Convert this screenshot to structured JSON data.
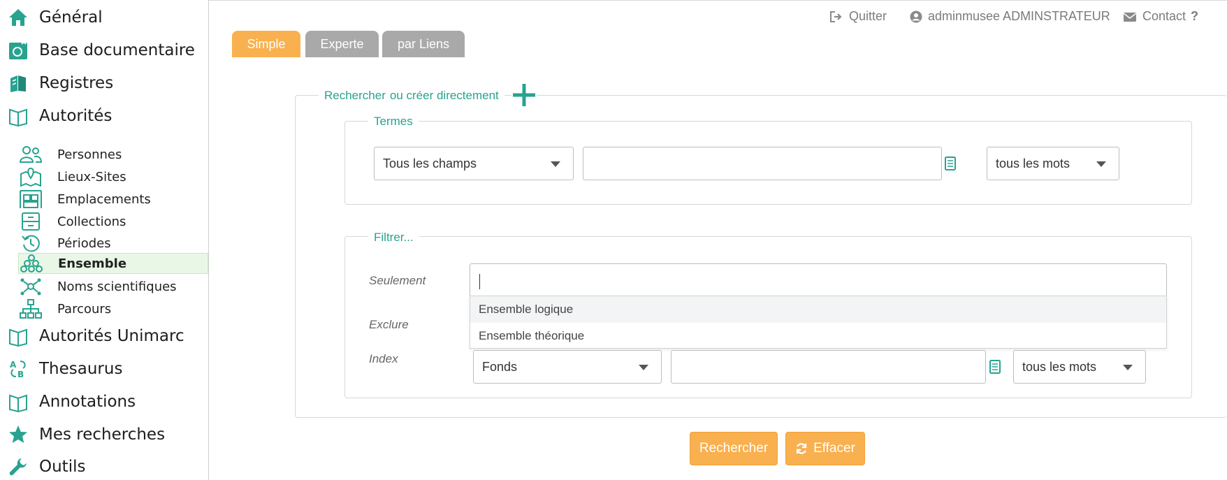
{
  "sidebar": {
    "top_items": [
      {
        "label": "Général"
      },
      {
        "label": "Base documentaire"
      },
      {
        "label": "Registres"
      },
      {
        "label": "Autorités"
      }
    ],
    "sub_items": [
      {
        "label": "Personnes"
      },
      {
        "label": "Lieux-Sites"
      },
      {
        "label": "Emplacements"
      },
      {
        "label": "Collections"
      },
      {
        "label": "Périodes"
      },
      {
        "label": "Ensemble",
        "active": true
      },
      {
        "label": "Noms scientifiques"
      },
      {
        "label": "Parcours"
      }
    ],
    "bottom_items": [
      {
        "label": "Autorités Unimarc"
      },
      {
        "label": "Thesaurus"
      },
      {
        "label": "Annotations"
      },
      {
        "label": "Mes recherches"
      },
      {
        "label": "Outils"
      }
    ]
  },
  "topbar": {
    "quit": "Quitter",
    "user": "adminmusee ADMINSTRATEUR",
    "contact": "Contact",
    "help": "?"
  },
  "tabs": [
    {
      "label": "Simple",
      "active": true
    },
    {
      "label": "Experte",
      "active": false
    },
    {
      "label": "par Liens",
      "active": false
    }
  ],
  "search": {
    "legend_search": "Rechercher",
    "legend_create": "ou créer directement",
    "terms_legend": "Termes",
    "terms_field": "Tous les champs",
    "terms_value": "",
    "terms_mode": "tous les mots",
    "filter_legend": "Filtrer...",
    "only_label": "Seulement",
    "only_value": "",
    "exclude_label": "Exclure",
    "index_label": "Index",
    "index_field": "Fonds",
    "index_value": "",
    "index_mode": "tous les mots",
    "dropdown_options": [
      "Ensemble logique",
      "Ensemble théorique"
    ]
  },
  "buttons": {
    "search": "Rechercher",
    "clear": "Effacer"
  },
  "colors": {
    "accent_green": "#27a38f",
    "tab_active": "#f9b04e",
    "tab_inactive": "#a9a9a9",
    "button": "#f9b04e"
  }
}
